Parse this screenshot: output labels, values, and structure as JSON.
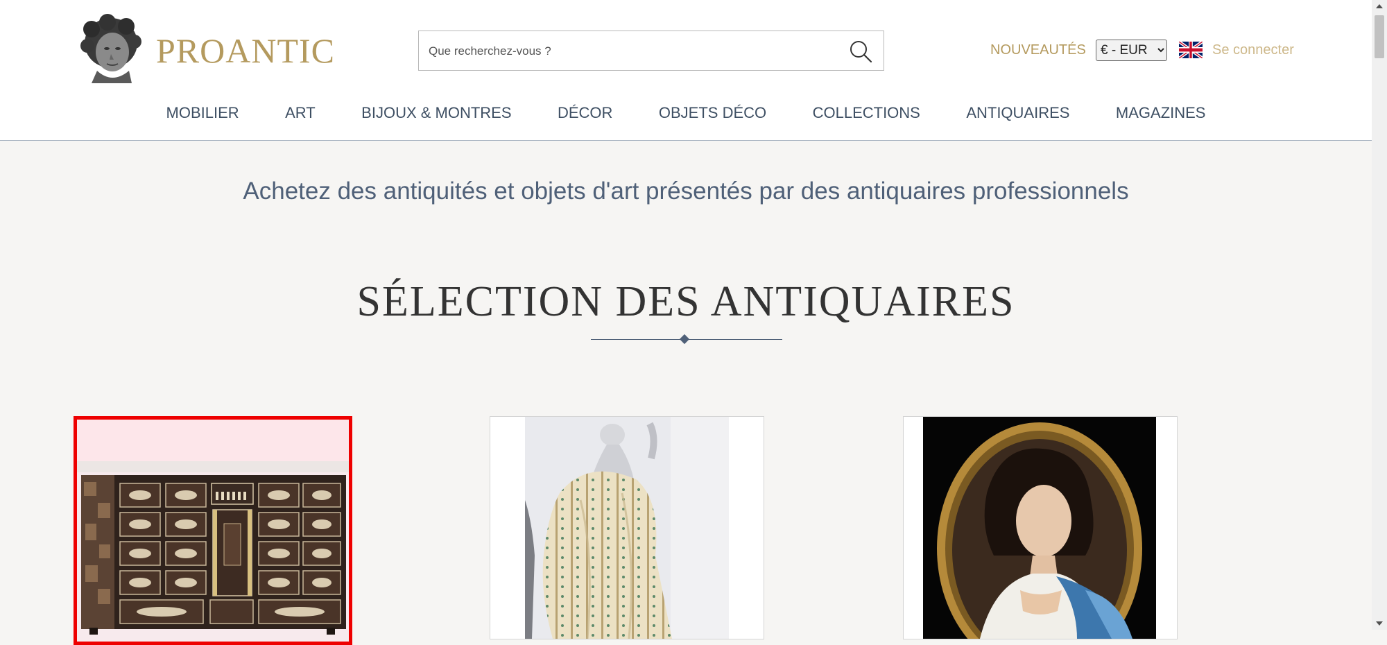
{
  "header": {
    "logo_text": "PROANTIC",
    "search": {
      "placeholder": "Que recherchez-vous ?",
      "value": ""
    },
    "nouveautes_label": "NOUVEAUTÉS",
    "currency": {
      "selected": "€ - EUR"
    },
    "login_label": "Se connecter"
  },
  "nav": {
    "items": [
      {
        "label": "MOBILIER"
      },
      {
        "label": "ART"
      },
      {
        "label": "BIJOUX & MONTRES"
      },
      {
        "label": "DÉCOR"
      },
      {
        "label": "OBJETS DÉCO"
      },
      {
        "label": "COLLECTIONS"
      },
      {
        "label": "ANTIQUAIRES"
      },
      {
        "label": "MAGAZINES"
      }
    ]
  },
  "main": {
    "tagline": "Achetez des antiquités et objets d'art présentés par des antiquaires professionnels",
    "section_title": "SÉLECTION DES ANTIQUAIRES"
  },
  "colors": {
    "brand_gold": "#b49a5e",
    "nav_text": "#3e4f63",
    "accent_blue_grey": "#4f6078",
    "selection_outline": "#ee0000"
  },
  "icons": {
    "search": "search-icon",
    "flag": "uk-flag-icon",
    "logo": "bust-logo-icon"
  }
}
